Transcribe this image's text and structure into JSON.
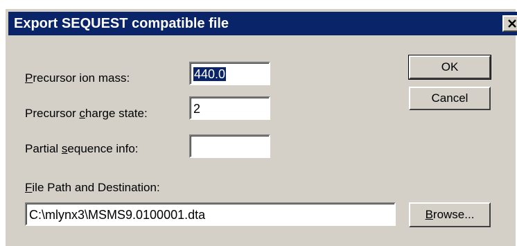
{
  "dialog": {
    "title": "Export SEQUEST compatible file",
    "close_glyph": "×"
  },
  "form": {
    "precursor_mass": {
      "label_accel": "P",
      "label_rest": "recursor ion mass:",
      "value": "440.0"
    },
    "precursor_charge": {
      "label_pre": "Precursor ",
      "label_accel": "c",
      "label_rest": "harge state:",
      "value": "2"
    },
    "partial_sequence": {
      "label_pre": "Partial ",
      "label_accel": "s",
      "label_rest": "equence info:",
      "value": ""
    },
    "file_path": {
      "label_accel": "F",
      "label_rest": "ile Path and Destination:",
      "value": "C:\\mlynx3\\MSMS9.0100001.dta"
    }
  },
  "buttons": {
    "ok": "OK",
    "cancel": "Cancel",
    "browse_accel": "B",
    "browse_rest": "rowse..."
  },
  "colors": {
    "face": "#d4d0c8",
    "titlebar": "#0a246a",
    "selection": "#0a246a"
  }
}
